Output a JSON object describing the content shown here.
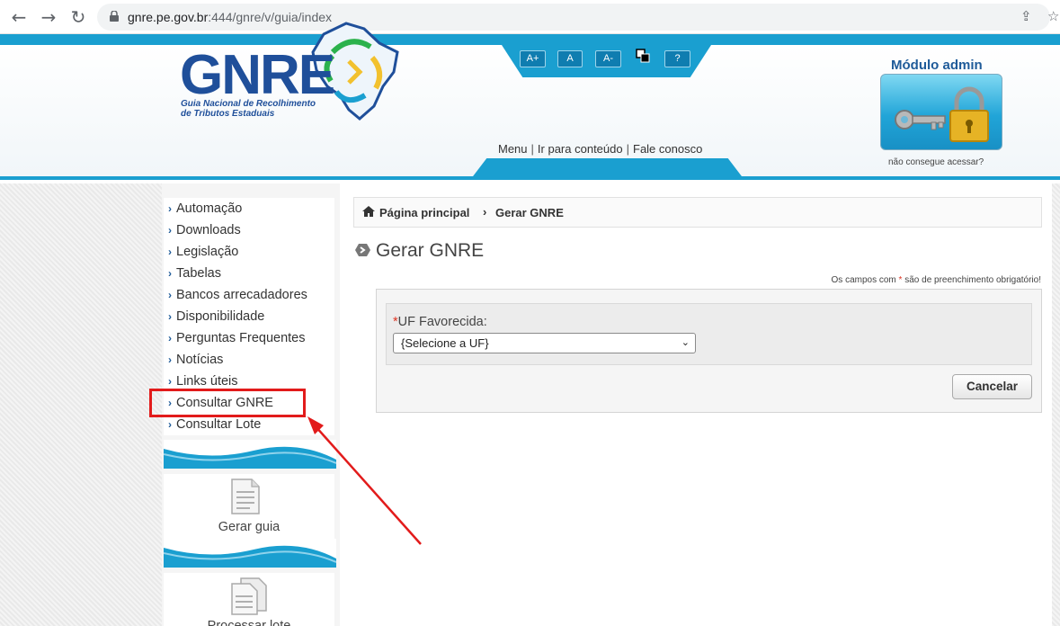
{
  "browser": {
    "url_domain": "gnre.pe.gov.br",
    "url_path": ":444/gnre/v/guia/index"
  },
  "header": {
    "logo_text": "GNRE",
    "logo_subtitle_1": "Guia Nacional de Recolhimento",
    "logo_subtitle_2": "de Tributos Estaduais",
    "font_controls": [
      "A+",
      "A",
      "A-",
      "?"
    ],
    "menu_links": [
      "Menu",
      "Ir para conteúdo",
      "Fale conosco"
    ],
    "admin_title": "Módulo admin",
    "admin_help": "não consegue acessar?"
  },
  "sidebar": {
    "items": [
      {
        "label": "Automação"
      },
      {
        "label": "Downloads"
      },
      {
        "label": "Legislação"
      },
      {
        "label": "Tabelas"
      },
      {
        "label": "Bancos arrecadadores"
      },
      {
        "label": "Disponibilidade"
      },
      {
        "label": "Perguntas Frequentes"
      },
      {
        "label": "Notícias"
      },
      {
        "label": "Links úteis"
      },
      {
        "label": "Consultar GNRE"
      },
      {
        "label": "Consultar Lote"
      }
    ],
    "card_gerar": "Gerar guia",
    "card_processar": "Processar lote"
  },
  "breadcrumb": {
    "home": "Página principal",
    "separator": "›",
    "current": "Gerar GNRE"
  },
  "page": {
    "title": "Gerar GNRE",
    "required_prefix": "Os campos com",
    "required_star": "*",
    "required_suffix": "são de preenchimento obrigatório!"
  },
  "form": {
    "uf_star": "*",
    "uf_label": "UF Favorecida:",
    "uf_selected": "{Selecione a UF}",
    "cancel_label": "Cancelar"
  },
  "colors": {
    "accent": "#1a9fd0",
    "brand": "#1f4f9a",
    "annotation": "#e21b1b"
  }
}
